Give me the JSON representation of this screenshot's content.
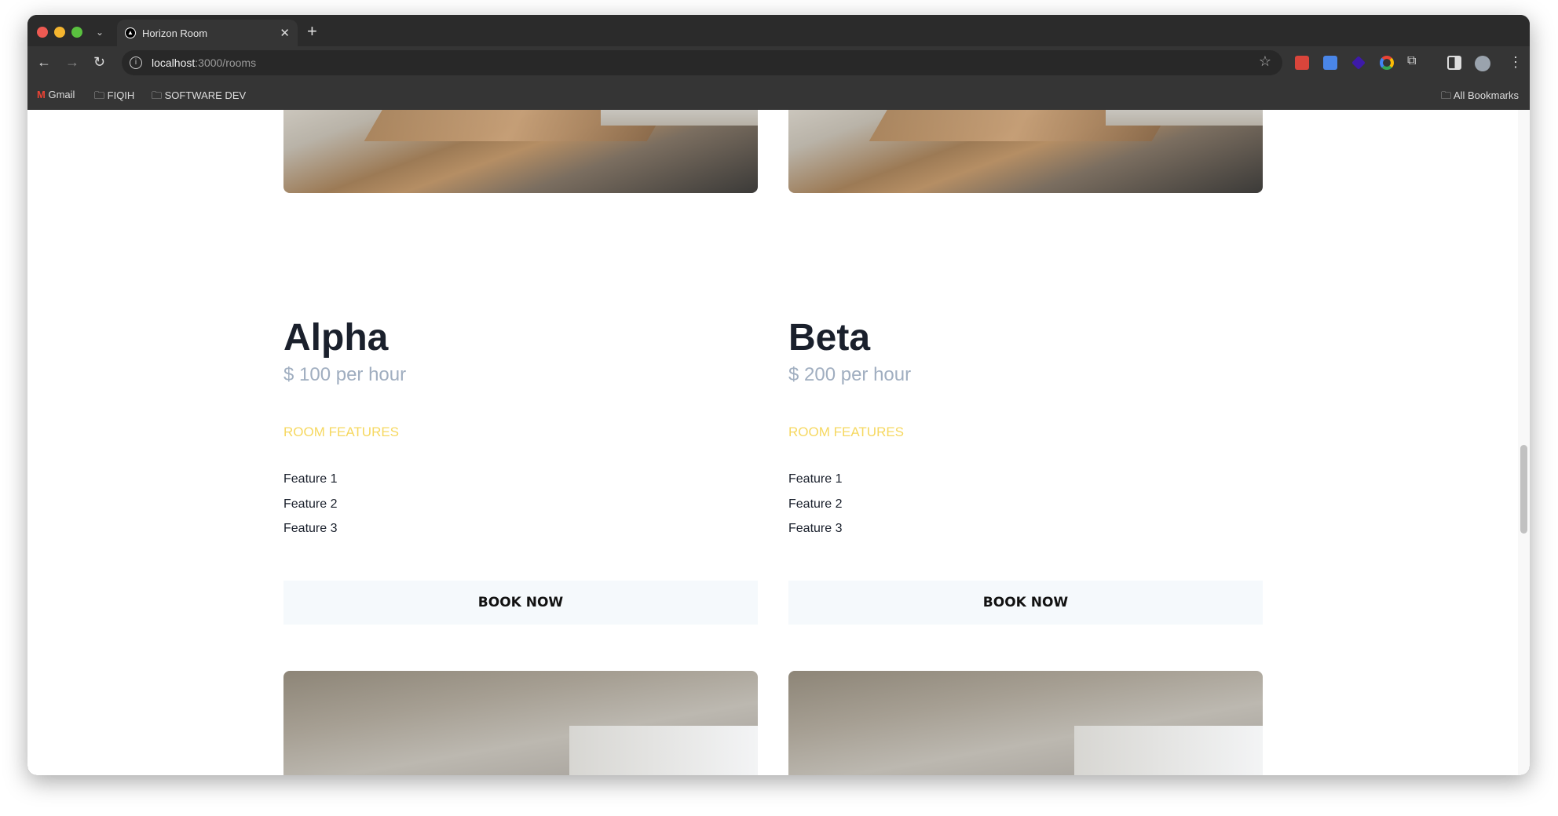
{
  "browser": {
    "tab_title": "Horizon Room",
    "url_host": "localhost",
    "url_rest": ":3000/rooms",
    "bookmarks": [
      "Gmail",
      "FIQIH",
      "SOFTWARE DEV"
    ],
    "all_bookmarks": "All Bookmarks"
  },
  "rooms": [
    {
      "name": "Alpha",
      "price": "$ 100 per hour",
      "features_heading": "ROOM FEATURES",
      "features": [
        "Feature 1",
        "Feature 2",
        "Feature 3"
      ],
      "button": "BOOK NOW"
    },
    {
      "name": "Beta",
      "price": "$ 200 per hour",
      "features_heading": "ROOM FEATURES",
      "features": [
        "Feature 1",
        "Feature 2",
        "Feature 3"
      ],
      "button": "BOOK NOW"
    }
  ],
  "colors": {
    "accent": "#f6d860",
    "title": "#1a202c",
    "price": "#a0aec0",
    "button_bg": "#f5f9fc"
  }
}
